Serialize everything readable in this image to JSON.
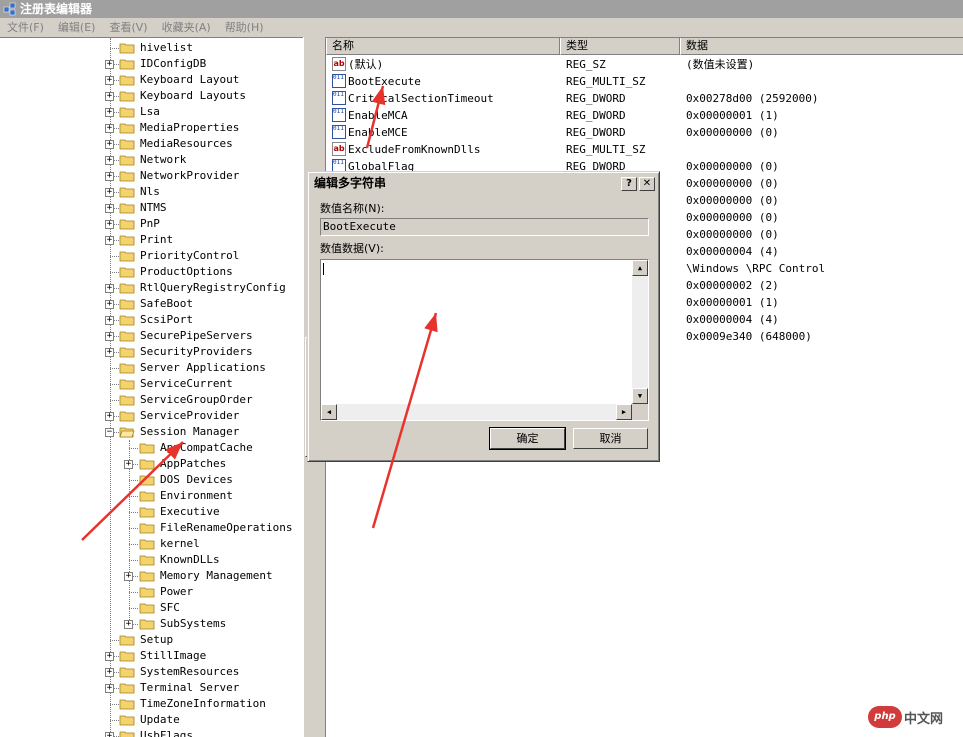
{
  "window": {
    "title": "注册表编辑器"
  },
  "menu": [
    "文件(F)",
    "编辑(E)",
    "查看(V)",
    "收藏夹(A)",
    "帮助(H)"
  ],
  "tree": {
    "items": [
      {
        "label": "hivelist",
        "expandable": false
      },
      {
        "label": "IDConfigDB",
        "expandable": true
      },
      {
        "label": "Keyboard Layout",
        "expandable": true
      },
      {
        "label": "Keyboard Layouts",
        "expandable": true
      },
      {
        "label": "Lsa",
        "expandable": true
      },
      {
        "label": "MediaProperties",
        "expandable": true
      },
      {
        "label": "MediaResources",
        "expandable": true
      },
      {
        "label": "Network",
        "expandable": true
      },
      {
        "label": "NetworkProvider",
        "expandable": true
      },
      {
        "label": "Nls",
        "expandable": true
      },
      {
        "label": "NTMS",
        "expandable": true
      },
      {
        "label": "PnP",
        "expandable": true
      },
      {
        "label": "Print",
        "expandable": true
      },
      {
        "label": "PriorityControl",
        "expandable": false
      },
      {
        "label": "ProductOptions",
        "expandable": false
      },
      {
        "label": "RtlQueryRegistryConfig",
        "expandable": true
      },
      {
        "label": "SafeBoot",
        "expandable": true
      },
      {
        "label": "ScsiPort",
        "expandable": true
      },
      {
        "label": "SecurePipeServers",
        "expandable": true
      },
      {
        "label": "SecurityProviders",
        "expandable": true
      },
      {
        "label": "Server Applications",
        "expandable": false
      },
      {
        "label": "ServiceCurrent",
        "expandable": false
      },
      {
        "label": "ServiceGroupOrder",
        "expandable": false
      },
      {
        "label": "ServiceProvider",
        "expandable": true
      },
      {
        "label": "Session Manager",
        "expandable": true,
        "expanded": true
      }
    ],
    "children": [
      {
        "label": "AppCompatCache",
        "expandable": false
      },
      {
        "label": "AppPatches",
        "expandable": true
      },
      {
        "label": "DOS Devices",
        "expandable": false
      },
      {
        "label": "Environment",
        "expandable": false
      },
      {
        "label": "Executive",
        "expandable": false
      },
      {
        "label": "FileRenameOperations",
        "expandable": false
      },
      {
        "label": "kernel",
        "expandable": false
      },
      {
        "label": "KnownDLLs",
        "expandable": false
      },
      {
        "label": "Memory Management",
        "expandable": true
      },
      {
        "label": "Power",
        "expandable": false
      },
      {
        "label": "SFC",
        "expandable": false
      },
      {
        "label": "SubSystems",
        "expandable": true
      }
    ],
    "after": [
      {
        "label": "Setup",
        "expandable": false
      },
      {
        "label": "StillImage",
        "expandable": true
      },
      {
        "label": "SystemResources",
        "expandable": true
      },
      {
        "label": "Terminal Server",
        "expandable": true
      },
      {
        "label": "TimeZoneInformation",
        "expandable": false
      },
      {
        "label": "Update",
        "expandable": false
      },
      {
        "label": "UsbFlags",
        "expandable": true
      }
    ]
  },
  "list": {
    "columns": [
      "名称",
      "类型",
      "数据"
    ],
    "rows": [
      {
        "icon": "ab",
        "name": "(默认)",
        "type": "REG_SZ",
        "data": "(数值未设置)"
      },
      {
        "icon": "bin",
        "name": "BootExecute",
        "type": "REG_MULTI_SZ",
        "data": ""
      },
      {
        "icon": "bin",
        "name": "CriticalSectionTimeout",
        "type": "REG_DWORD",
        "data": "0x00278d00 (2592000)"
      },
      {
        "icon": "bin",
        "name": "EnableMCA",
        "type": "REG_DWORD",
        "data": "0x00000001 (1)"
      },
      {
        "icon": "bin",
        "name": "EnableMCE",
        "type": "REG_DWORD",
        "data": "0x00000000 (0)"
      },
      {
        "icon": "ab",
        "name": "ExcludeFromKnownDlls",
        "type": "REG_MULTI_SZ",
        "data": ""
      },
      {
        "icon": "bin",
        "name": "GlobalFlag",
        "type": "REG_DWORD",
        "data": "0x00000000 (0)"
      },
      {
        "icon": "",
        "name": "",
        "type": "",
        "data": "0x00000000 (0)"
      },
      {
        "icon": "",
        "name": "",
        "type": "",
        "data": "0x00000000 (0)"
      },
      {
        "icon": "",
        "name": "",
        "type": "",
        "data": "0x00000000 (0)"
      },
      {
        "icon": "",
        "name": "",
        "type": "",
        "data": "0x00000000 (0)"
      },
      {
        "icon": "",
        "name": "",
        "type": "",
        "data": "0x00000004 (4)"
      },
      {
        "icon": "",
        "name": "",
        "type": "",
        "data": "\\Windows \\RPC Control"
      },
      {
        "icon": "",
        "name": "",
        "type": "",
        "data": "0x00000002 (2)"
      },
      {
        "icon": "",
        "name": "",
        "type": "",
        "data": "0x00000001 (1)"
      },
      {
        "icon": "",
        "name": "",
        "type": "",
        "data": "0x00000004 (4)"
      },
      {
        "icon": "",
        "name": "",
        "type": "",
        "data": "0x0009e340 (648000)"
      }
    ]
  },
  "dialog": {
    "title": "编辑多字符串",
    "help_glyph": "?",
    "close_glyph": "✕",
    "name_label": "数值名称(N):",
    "name_value": "BootExecute",
    "data_label": "数值数据(V):",
    "data_value": "",
    "ok_label": "确定",
    "cancel_label": "取消"
  },
  "annotation_color": "#e8332d",
  "watermark": {
    "logo": "php",
    "text": "中文网"
  }
}
